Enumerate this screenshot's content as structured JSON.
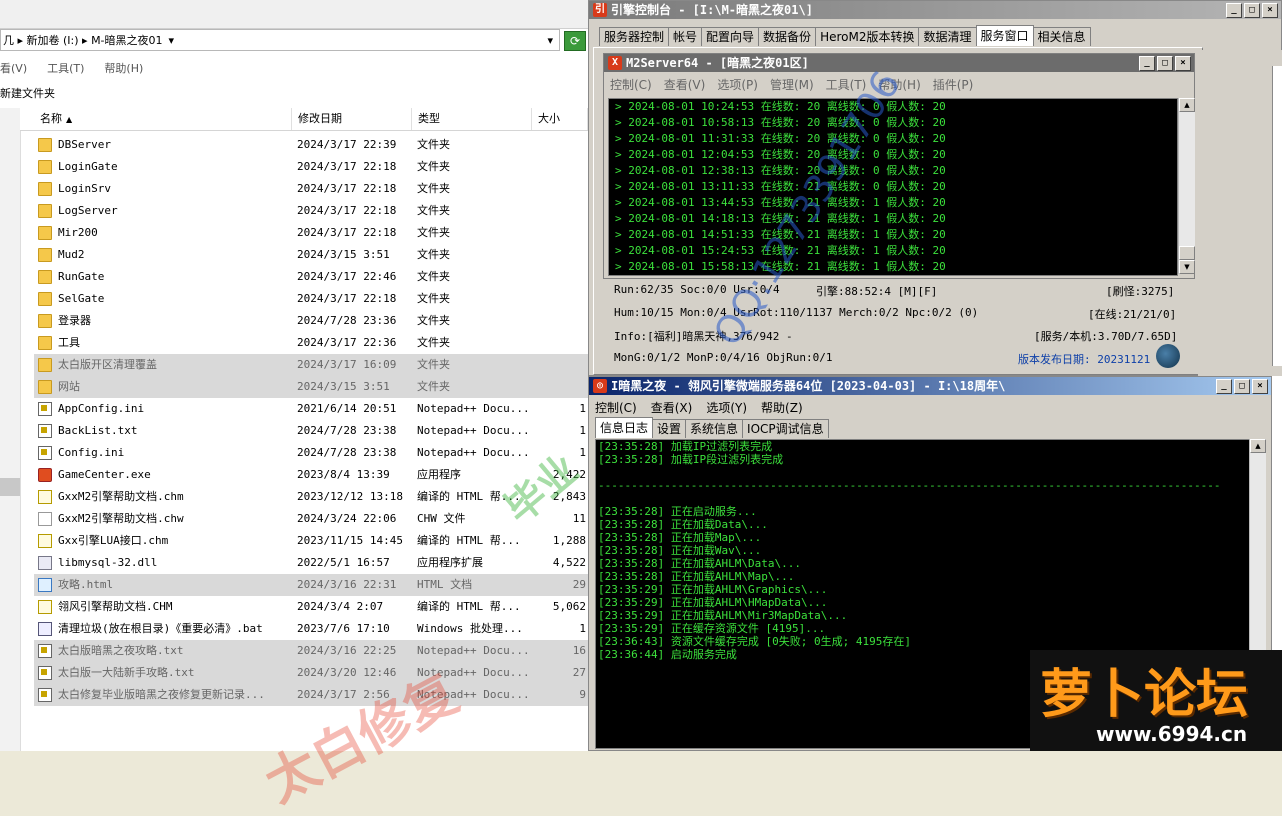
{
  "explorer": {
    "address": [
      "几",
      "新加卷 (I:)",
      "M-暗黑之夜01"
    ],
    "menu": [
      "看(V)",
      "工具(T)",
      "帮助(H)"
    ],
    "new_folder": "新建文件夹",
    "columns": {
      "name": "名称",
      "date": "修改日期",
      "type": "类型",
      "size": "大小"
    },
    "files": [
      {
        "icon": "folder",
        "name": "DBServer",
        "date": "2024/3/17 22:39",
        "type": "文件夹",
        "size": ""
      },
      {
        "icon": "folder",
        "name": "LoginGate",
        "date": "2024/3/17 22:18",
        "type": "文件夹",
        "size": ""
      },
      {
        "icon": "folder",
        "name": "LoginSrv",
        "date": "2024/3/17 22:18",
        "type": "文件夹",
        "size": ""
      },
      {
        "icon": "folder",
        "name": "LogServer",
        "date": "2024/3/17 22:18",
        "type": "文件夹",
        "size": ""
      },
      {
        "icon": "folder",
        "name": "Mir200",
        "date": "2024/3/17 22:18",
        "type": "文件夹",
        "size": ""
      },
      {
        "icon": "folder",
        "name": "Mud2",
        "date": "2024/3/15 3:51",
        "type": "文件夹",
        "size": ""
      },
      {
        "icon": "folder",
        "name": "RunGate",
        "date": "2024/3/17 22:46",
        "type": "文件夹",
        "size": ""
      },
      {
        "icon": "folder",
        "name": "SelGate",
        "date": "2024/3/17 22:18",
        "type": "文件夹",
        "size": ""
      },
      {
        "icon": "folder",
        "name": "登录器",
        "date": "2024/7/28 23:36",
        "type": "文件夹",
        "size": ""
      },
      {
        "icon": "folder",
        "name": "工具",
        "date": "2024/3/17 22:36",
        "type": "文件夹",
        "size": ""
      },
      {
        "icon": "folder",
        "name": "太白版开区清理覆盖",
        "date": "2024/3/17 16:09",
        "type": "文件夹",
        "size": "",
        "selected": true
      },
      {
        "icon": "folder",
        "name": "网站",
        "date": "2024/3/15 3:51",
        "type": "文件夹",
        "size": "",
        "selected": true
      },
      {
        "icon": "note",
        "name": "AppConfig.ini",
        "date": "2021/6/14 20:51",
        "type": "Notepad++ Docu...",
        "size": "1"
      },
      {
        "icon": "note",
        "name": "BackList.txt",
        "date": "2024/7/28 23:38",
        "type": "Notepad++ Docu...",
        "size": "1"
      },
      {
        "icon": "note",
        "name": "Config.ini",
        "date": "2024/7/28 23:38",
        "type": "Notepad++ Docu...",
        "size": "1"
      },
      {
        "icon": "exe",
        "name": "GameCenter.exe",
        "date": "2023/8/4 13:39",
        "type": "应用程序",
        "size": "2,422"
      },
      {
        "icon": "chm",
        "name": "GxxM2引擎帮助文档.chm",
        "date": "2023/12/12 13:18",
        "type": "编译的 HTML 帮...",
        "size": "2,843"
      },
      {
        "icon": "file",
        "name": "GxxM2引擎帮助文档.chw",
        "date": "2024/3/24 22:06",
        "type": "CHW 文件",
        "size": "11"
      },
      {
        "icon": "chm",
        "name": "Gxx引擎LUA接口.chm",
        "date": "2023/11/15 14:45",
        "type": "编译的 HTML 帮...",
        "size": "1,288"
      },
      {
        "icon": "dll",
        "name": "libmysql-32.dll",
        "date": "2022/5/1 16:57",
        "type": "应用程序扩展",
        "size": "4,522"
      },
      {
        "icon": "html",
        "name": "攻略.html",
        "date": "2024/3/16 22:31",
        "type": "HTML 文档",
        "size": "29",
        "selected": true
      },
      {
        "icon": "chm",
        "name": "翎风引擎帮助文档.CHM",
        "date": "2024/3/4 2:07",
        "type": "编译的 HTML 帮...",
        "size": "5,062"
      },
      {
        "icon": "bat",
        "name": "清理垃圾(放在根目录)《重要必清》.bat",
        "date": "2023/7/6 17:10",
        "type": "Windows 批处理...",
        "size": "1"
      },
      {
        "icon": "note",
        "name": "太白版暗黑之夜攻略.txt",
        "date": "2024/3/16 22:25",
        "type": "Notepad++ Docu...",
        "size": "16",
        "selected": true
      },
      {
        "icon": "note",
        "name": "太白版一大陆新手攻略.txt",
        "date": "2024/3/20 12:46",
        "type": "Notepad++ Docu...",
        "size": "27",
        "selected": true
      },
      {
        "icon": "note",
        "name": "太白修复毕业版暗黑之夜修复更新记录...",
        "date": "2024/3/17 2:56",
        "type": "Notepad++ Docu...",
        "size": "9",
        "selected": true
      }
    ]
  },
  "engine": {
    "title": "引擎控制台 - [I:\\M-暗黑之夜01\\]",
    "tabs": [
      "服务器控制",
      "帐号",
      "配置向导",
      "数据备份",
      "HeroM2版本转换",
      "数据清理",
      "服务窗口",
      "相关信息"
    ],
    "active_tab": "服务窗口",
    "m2": {
      "title": "M2Server64 - [暗黑之夜01区]",
      "menu": [
        "控制(C)",
        "查看(V)",
        "选项(P)",
        "管理(M)",
        "工具(T)",
        "帮助(H)",
        "插件(P)"
      ],
      "log": [
        "> 2024-08-01 10:24:53 在线数: 20 离线数: 0 假人数: 20",
        "> 2024-08-01 10:58:13 在线数: 20 离线数: 0 假人数: 20",
        "> 2024-08-01 11:31:33 在线数: 20 离线数: 0 假人数: 20",
        "> 2024-08-01 12:04:53 在线数: 20 离线数: 0 假人数: 20",
        "> 2024-08-01 12:38:13 在线数: 20 离线数: 0 假人数: 20",
        "> 2024-08-01 13:11:33 在线数: 21 离线数: 0 假人数: 20",
        "> 2024-08-01 13:44:53 在线数: 21 离线数: 1 假人数: 20",
        "> 2024-08-01 14:18:13 在线数: 21 离线数: 1 假人数: 20",
        "> 2024-08-01 14:51:33 在线数: 21 离线数: 1 假人数: 20",
        "> 2024-08-01 15:24:53 在线数: 21 离线数: 1 假人数: 20",
        "> 2024-08-01 15:58:13 在线数: 21 离线数: 1 假人数: 20"
      ]
    },
    "stats": {
      "run": "Run:62/35 Soc:0/0 Usr:0/4",
      "engine": "引擎:88:52:4 [M][F]",
      "refresh": "[刷怪:3275]",
      "hum": "Hum:10/15 Mon:0/4 UsrRot:110/1137 Merch:0/2 Npc:0/2 (0)",
      "online": "[在线:21/21/0]",
      "info": "Info:[福利]暗黑天神,376/942 -",
      "service": "[服务/本机:3.70D/7.65D]",
      "mong": "MonG:0/1/2 MonP:0/4/16 ObjRun:0/1",
      "release": "版本发布日期: 20231121"
    }
  },
  "micro": {
    "title": "I暗黑之夜 - 翎风引擎微端服务器64位 [2023-04-03] - I:\\18周年\\",
    "menu": [
      "控制(C)",
      "查看(X)",
      "选项(Y)",
      "帮助(Z)"
    ],
    "tabs": [
      "信息日志",
      "设置",
      "系统信息",
      "IOCP调试信息"
    ],
    "active_tab": "信息日志",
    "log": [
      "[23:35:28] 加载IP过滤列表完成",
      "[23:35:28] 加载IP段过滤列表完成",
      "",
      "----------------------------------------------------------------------------------------------",
      "",
      "[23:35:28] 正在启动服务...",
      "[23:35:28] 正在加载Data\\...",
      "[23:35:28] 正在加载Map\\...",
      "[23:35:28] 正在加载Wav\\...",
      "[23:35:28] 正在加载AHLM\\Data\\...",
      "[23:35:28] 正在加载AHLM\\Map\\...",
      "[23:35:29] 正在加载AHLM\\Graphics\\...",
      "[23:35:29] 正在加载AHLM\\HMapData\\...",
      "[23:35:29] 正在加载AHLM\\Mir3MapData\\...",
      "[23:35:29] 正在缓存资源文件 [4195]...",
      "[23:36:43] 资源文件缓存完成 [0失败; 0生成; 4195存在]",
      "[23:36:44] 启动服务完成"
    ]
  },
  "watermarks": {
    "blue": "QQ:1273391706",
    "red": "太白修复",
    "green": "毕业",
    "forum_name": "萝卜论坛",
    "forum_url": "www.6994.cn"
  },
  "colors": {
    "log_green": "#3ce03c",
    "log_bg": "#000000",
    "release_blue": "#0d3fa8"
  }
}
